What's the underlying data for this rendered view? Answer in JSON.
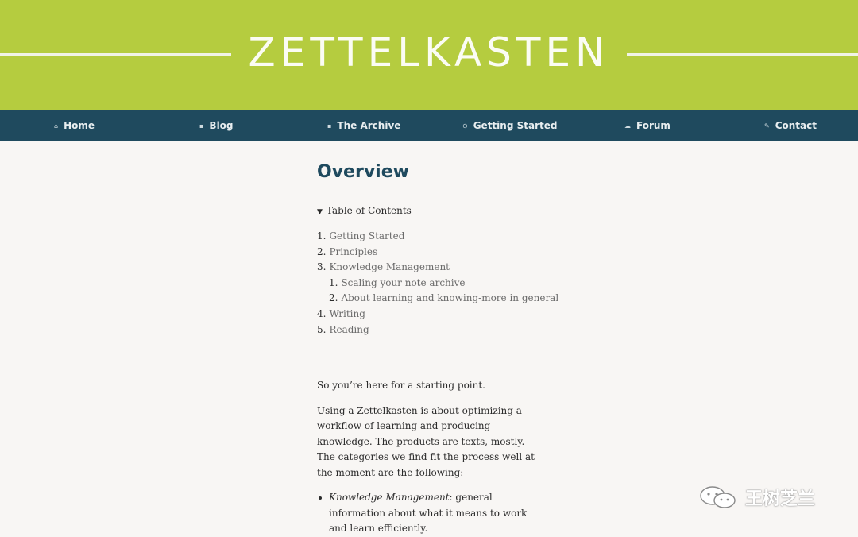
{
  "site_title": "ZETTELKASTEN",
  "nav": [
    {
      "label": "Home",
      "icon": "home-icon",
      "glyph": "⌂"
    },
    {
      "label": "Blog",
      "icon": "blog-icon",
      "glyph": "▪"
    },
    {
      "label": "The Archive",
      "icon": "archive-icon",
      "glyph": "▪"
    },
    {
      "label": "Getting Started",
      "icon": "getting-started-icon",
      "glyph": "⊙"
    },
    {
      "label": "Forum",
      "icon": "forum-icon",
      "glyph": "☁"
    },
    {
      "label": "Contact",
      "icon": "contact-icon",
      "glyph": "✎"
    }
  ],
  "page": {
    "title": "Overview",
    "toc_label": "Table of Contents",
    "toc": [
      {
        "num": "1.",
        "label": "Getting Started"
      },
      {
        "num": "2.",
        "label": "Principles"
      },
      {
        "num": "3.",
        "label": "Knowledge Management"
      },
      {
        "num": "1.",
        "label": "Scaling your note archive"
      },
      {
        "num": "2.",
        "label": "About learning and knowing-more in general"
      },
      {
        "num": "4.",
        "label": "Writing"
      },
      {
        "num": "5.",
        "label": "Reading"
      }
    ],
    "intro": "So you’re here for a starting point.",
    "paragraph": "Using a Zettelkasten is about optimizing a workflow of learning and producing knowledge. The products are texts, mostly. The categories we find fit the process well at the moment are the following:",
    "list_item": {
      "term": "Knowledge Management",
      "rest": ": general information about what it means to work and learn efficiently."
    }
  },
  "watermark": {
    "text": "王树芝兰"
  },
  "colors": {
    "header_bg": "#b5cc3f",
    "nav_bg": "#1f4a5e",
    "title_color": "#1f4a5e",
    "page_bg": "#f8f6f4"
  }
}
